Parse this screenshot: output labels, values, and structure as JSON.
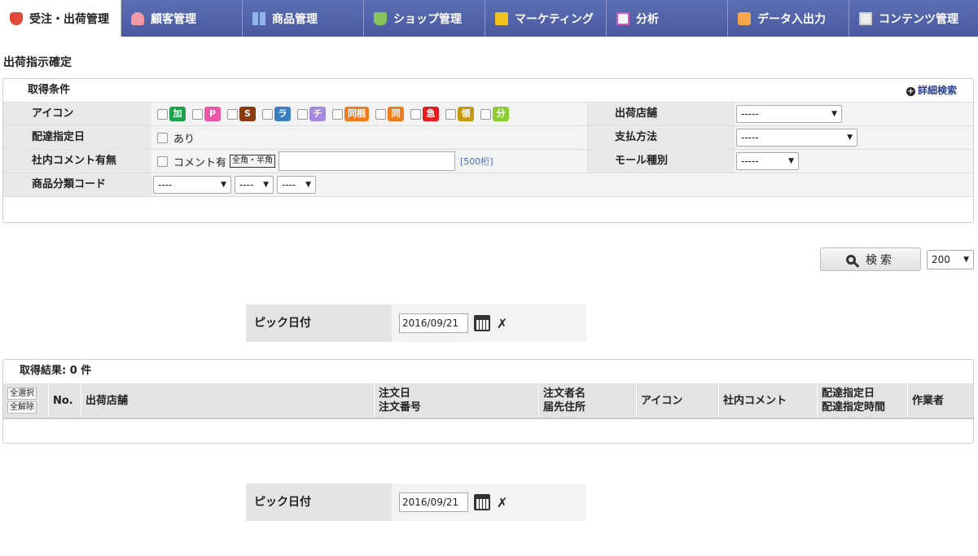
{
  "nav": {
    "tabs": [
      {
        "label": "受注・出荷管理",
        "icon": "order-icon"
      },
      {
        "label": "顧客管理",
        "icon": "person-icon"
      },
      {
        "label": "商品管理",
        "icon": "grid-icon"
      },
      {
        "label": "ショップ管理",
        "icon": "cart-icon"
      },
      {
        "label": "マーケティング",
        "icon": "chat-icon"
      },
      {
        "label": "分析",
        "icon": "chart-icon"
      },
      {
        "label": "データ入出力",
        "icon": "edit-icon"
      },
      {
        "label": "コンテンツ管理",
        "icon": "doc-icon"
      }
    ]
  },
  "page_title": "出荷指示確定",
  "conditions": {
    "heading": "取得条件",
    "detail_link": "詳細検索",
    "icon_label": "アイコン",
    "icon_chips": [
      {
        "text": "加",
        "color": "#1aa34a"
      },
      {
        "text": "P",
        "color": "#ee55a6"
      },
      {
        "text": "S",
        "color": "#8b3a12"
      },
      {
        "text": "ラ",
        "color": "#3c7fc1"
      },
      {
        "text": "チ",
        "color": "#a58ae0"
      },
      {
        "text": "同梱",
        "color": "#ef7b1a"
      },
      {
        "text": "同",
        "color": "#ef7b1a"
      },
      {
        "text": "急",
        "color": "#e8191f"
      },
      {
        "text": "領",
        "color": "#c49a12"
      },
      {
        "text": "分",
        "color": "#8ccd2f"
      }
    ],
    "delivery_label": "配達指定日",
    "delivery_option": "あり",
    "comment_label": "社内コメント有無",
    "comment_option": "コメント有",
    "comment_width_tag": "全角・半角",
    "comment_hint": "[500桁]",
    "category_label": "商品分類コード",
    "category_selects": [
      "----",
      "----",
      "----"
    ],
    "store_label": "出荷店舗",
    "store_value": "-----",
    "payment_label": "支払方法",
    "payment_value": "-----",
    "mall_label": "モール種別",
    "mall_value": "-----"
  },
  "search": {
    "button_label": "検索",
    "count_value": "200"
  },
  "pick_date": {
    "label": "ピック日付",
    "value": "2016/09/21"
  },
  "results": {
    "heading": "取得結果: 0 件",
    "select_all": "全選択",
    "deselect_all": "全解除",
    "columns": {
      "no": "No.",
      "store": "出荷店舗",
      "order_date": "注文日",
      "order_number": "注文番号",
      "orderer": "注文者名",
      "address": "届先住所",
      "icon": "アイコン",
      "comment": "社内コメント",
      "delivery_date": "配達指定日",
      "delivery_time": "配達指定時間",
      "worker": "作業者"
    }
  }
}
